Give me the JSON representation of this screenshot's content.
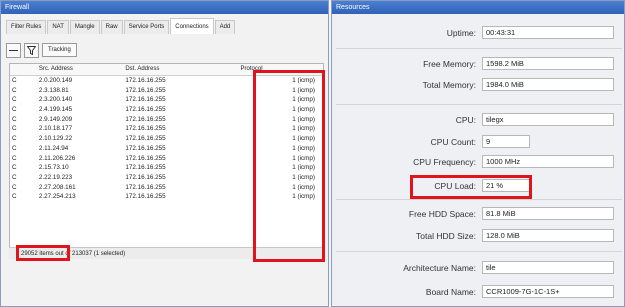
{
  "left_window": {
    "title": "Firewall",
    "tabs": [
      "Filter Rules",
      "NAT",
      "Mangle",
      "Raw",
      "Service Ports",
      "Connections",
      "Add"
    ],
    "active_tab_index": 5,
    "toolbar": {
      "remove_icon": "minus-icon",
      "filter_icon": "funnel-icon",
      "tracking_label": "Tracking"
    },
    "columns": [
      "",
      "Src. Address",
      "Dst. Address",
      "Protocol"
    ],
    "rows": [
      [
        "C",
        "2.0.200.149",
        "172.16.16.255",
        "1 (icmp)"
      ],
      [
        "C",
        "2.3.138.81",
        "172.16.16.255",
        "1 (icmp)"
      ],
      [
        "C",
        "2.3.200.140",
        "172.16.16.255",
        "1 (icmp)"
      ],
      [
        "C",
        "2.4.199.145",
        "172.16.16.255",
        "1 (icmp)"
      ],
      [
        "C",
        "2.9.149.209",
        "172.16.16.255",
        "1 (icmp)"
      ],
      [
        "C",
        "2.10.18.177",
        "172.16.16.255",
        "1 (icmp)"
      ],
      [
        "C",
        "2.10.129.22",
        "172.16.16.255",
        "1 (icmp)"
      ],
      [
        "C",
        "2.11.24.94",
        "172.16.16.255",
        "1 (icmp)"
      ],
      [
        "C",
        "2.11.206.226",
        "172.16.16.255",
        "1 (icmp)"
      ],
      [
        "C",
        "2.15.73.10",
        "172.16.16.255",
        "1 (icmp)"
      ],
      [
        "C",
        "2.22.19.223",
        "172.16.16.255",
        "1 (icmp)"
      ],
      [
        "C",
        "2.27.208.161",
        "172.16.16.255",
        "1 (icmp)"
      ],
      [
        "C",
        "2.27.254.213",
        "172.16.16.255",
        "1 (icmp)"
      ]
    ],
    "status": {
      "items_count": "29052 items",
      "rest": "out of 213037 (1 selected)"
    }
  },
  "right_window": {
    "title": "Resources",
    "fields": [
      {
        "label": "Uptime:",
        "value": "00:43:31"
      },
      {
        "label": "Free Memory:",
        "value": "1598.2 MiB"
      },
      {
        "label": "Total Memory:",
        "value": "1984.0 MiB"
      },
      {
        "label": "CPU:",
        "value": "tilegx"
      },
      {
        "label": "CPU Count:",
        "value": "9"
      },
      {
        "label": "CPU Frequency:",
        "value": "1000 MHz"
      },
      {
        "label": "CPU Load:",
        "value": "21 %"
      },
      {
        "label": "Free HDD Space:",
        "value": "81.8 MiB"
      },
      {
        "label": "Total HDD Size:",
        "value": "128.0 MiB"
      },
      {
        "label": "Architecture Name:",
        "value": "tile"
      },
      {
        "label": "Board Name:",
        "value": "CCR1009-7G-1C-1S+"
      }
    ]
  },
  "colors": {
    "highlight": "#e0141c",
    "titlebar": "#3a6fc4"
  }
}
